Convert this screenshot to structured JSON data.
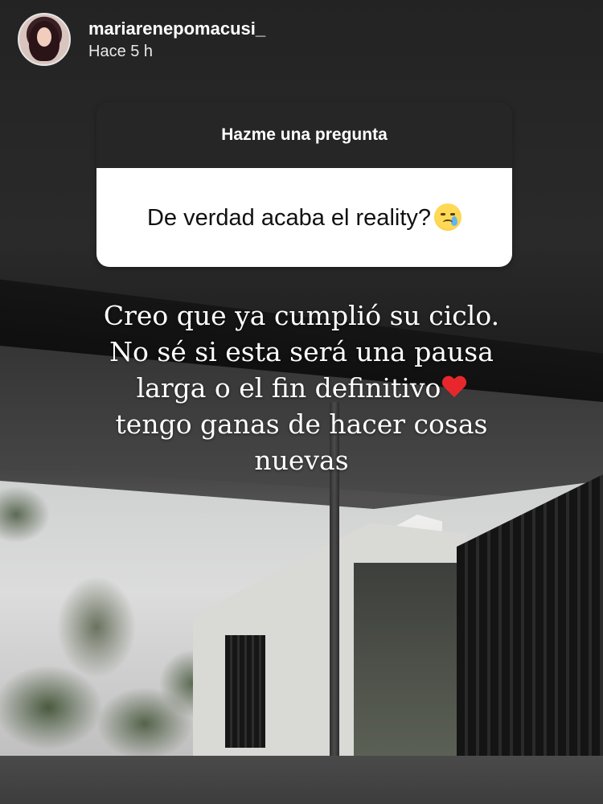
{
  "header": {
    "username": "mariarenepomacusi_",
    "timestamp": "Hace 5 h",
    "avatar_icon": "profile-photo"
  },
  "question_sticker": {
    "prompt": "Hazme una pregunta",
    "question": "De verdad acaba el reality?",
    "question_emoji": "crying-face-emoji",
    "header_bg": "#262626",
    "body_bg": "#ffffff"
  },
  "answer": {
    "lines": [
      "Creo que ya cumplió su ciclo.",
      "No sé si esta será una pausa",
      "larga o el fin definitivo",
      "tengo ganas de hacer cosas",
      "nuevas"
    ],
    "heart_emoji": "red-heart-emoji",
    "text_color": "#ffffff"
  }
}
